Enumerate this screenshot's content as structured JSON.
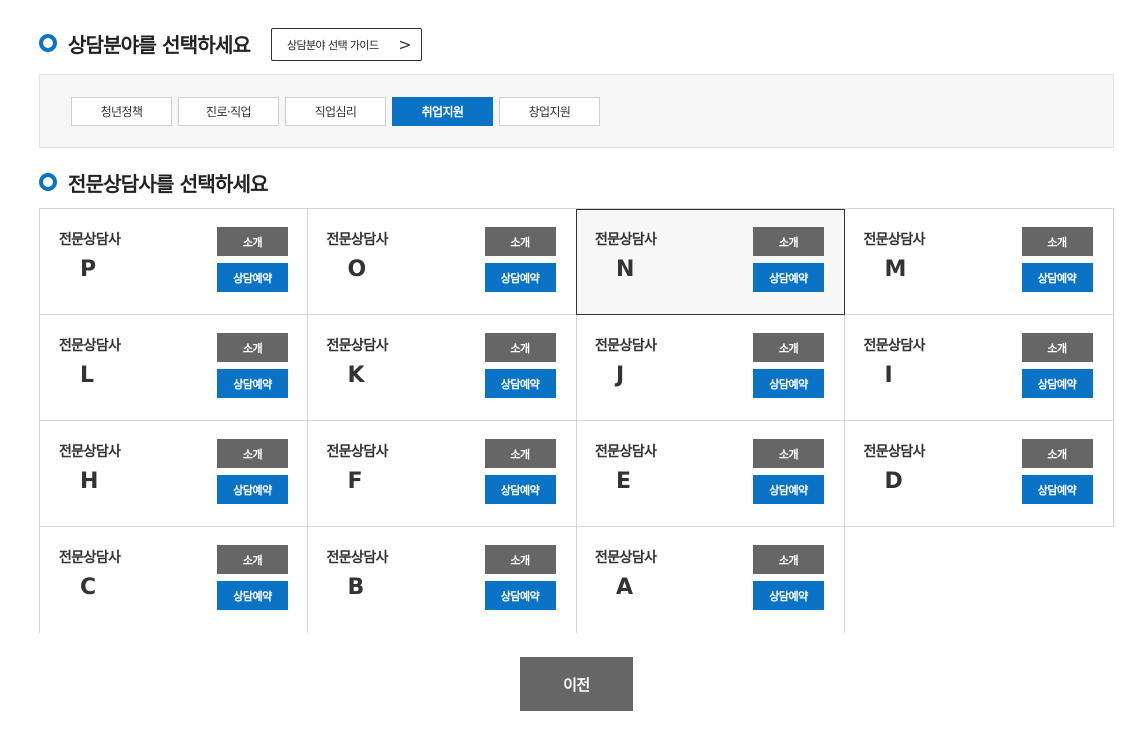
{
  "section_field": {
    "title": "상담분야를 선택하세요",
    "guide_button": "상담분야 선택 가이드",
    "guide_chevron": ">",
    "tabs": [
      {
        "label": "청년정책",
        "active": false
      },
      {
        "label": "진로·직업",
        "active": false
      },
      {
        "label": "직업심리",
        "active": false
      },
      {
        "label": "취업지원",
        "active": true
      },
      {
        "label": "창업지원",
        "active": false
      }
    ]
  },
  "section_counselor": {
    "title": "전문상담사를 선택하세요",
    "role_label": "전문상담사",
    "intro_label": "소개",
    "reserve_label": "상담예약",
    "counselors": [
      {
        "letter": "P",
        "selected": false
      },
      {
        "letter": "O",
        "selected": false
      },
      {
        "letter": "N",
        "selected": true
      },
      {
        "letter": "M",
        "selected": false
      },
      {
        "letter": "L",
        "selected": false
      },
      {
        "letter": "K",
        "selected": false
      },
      {
        "letter": "J",
        "selected": false
      },
      {
        "letter": "I",
        "selected": false
      },
      {
        "letter": "H",
        "selected": false
      },
      {
        "letter": "F",
        "selected": false
      },
      {
        "letter": "E",
        "selected": false
      },
      {
        "letter": "D",
        "selected": false
      },
      {
        "letter": "C",
        "selected": false
      },
      {
        "letter": "B",
        "selected": false
      },
      {
        "letter": "A",
        "selected": false
      }
    ]
  },
  "footer": {
    "prev_label": "이전"
  },
  "colors": {
    "accent": "#0b73c6",
    "dark_button": "#666666",
    "panel_bg": "#f6f6f6"
  },
  "icons": {
    "heading_bullet": "ring-bullet-icon",
    "guide_arrow": "chevron-right-icon"
  }
}
